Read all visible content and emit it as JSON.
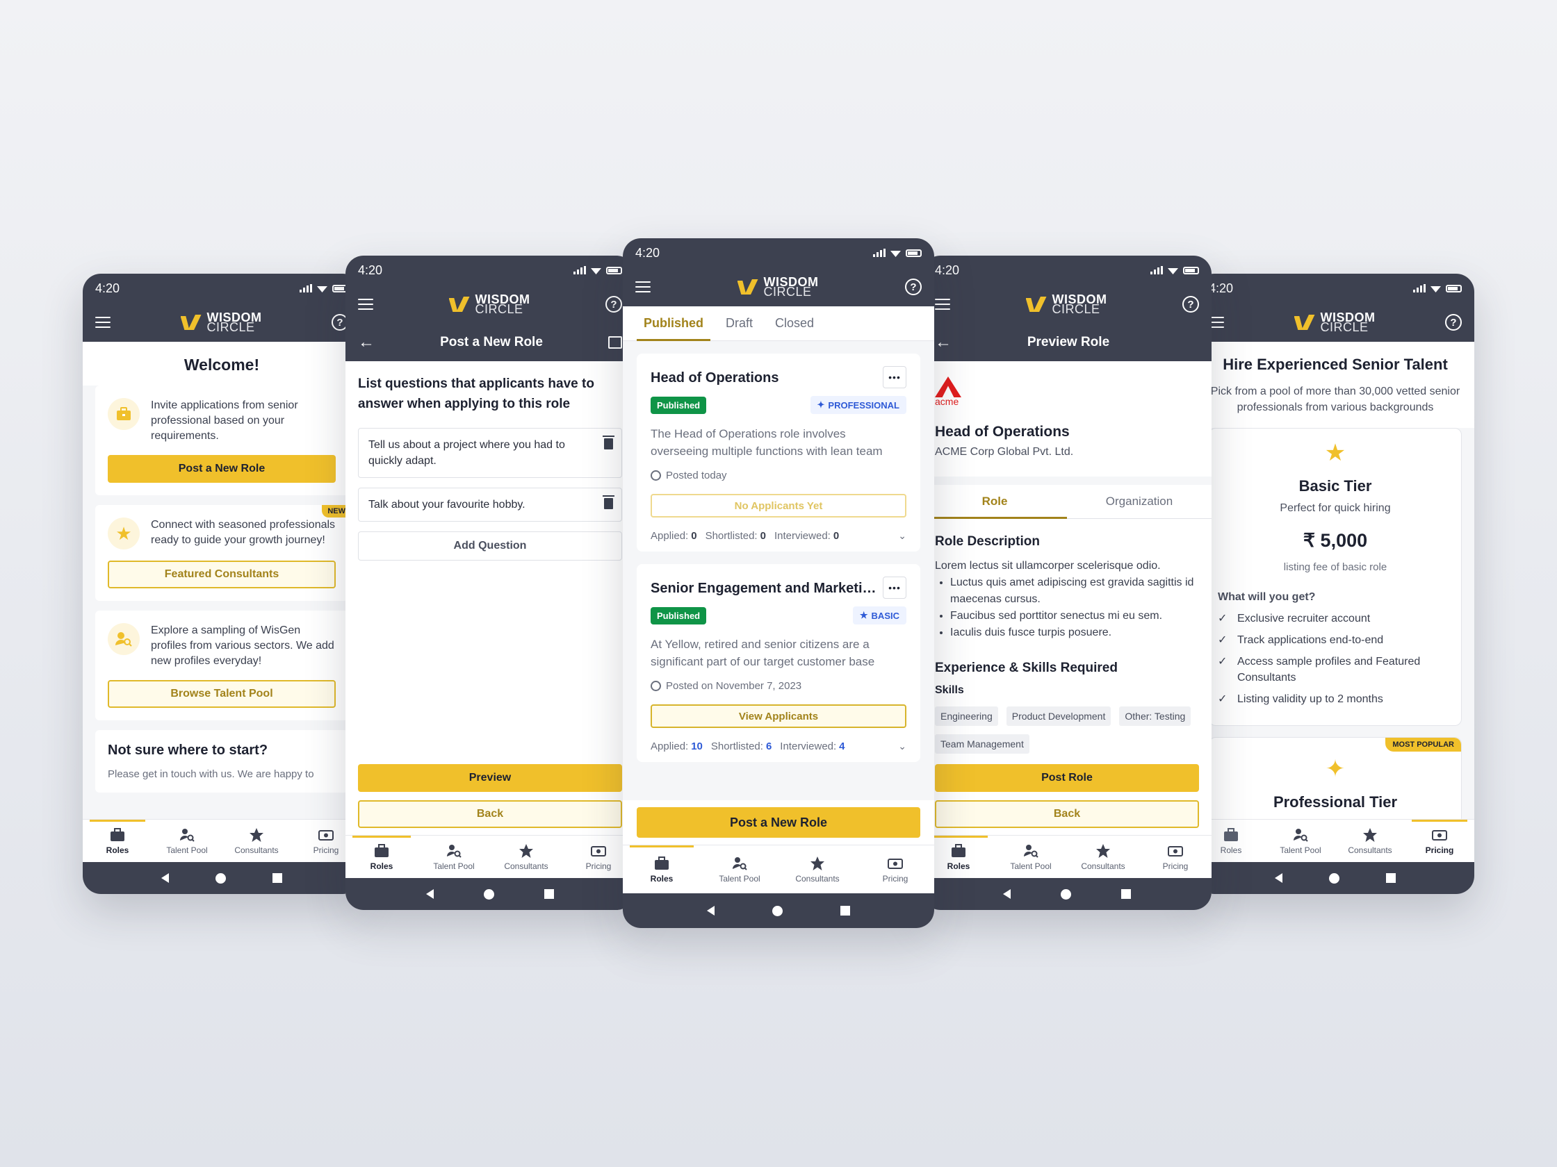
{
  "status_time": "4:20",
  "brand": {
    "line1": "WISDOM",
    "line2": "CIRCLE"
  },
  "help_glyph": "?",
  "bottom_nav": [
    "Roles",
    "Talent Pool",
    "Consultants",
    "Pricing"
  ],
  "screen1": {
    "title": "Welcome!",
    "card1_text": "Invite applications from senior professional based on your requirements.",
    "card1_button": "Post a New Role",
    "new_badge": "NEW",
    "card2_text": "Connect with seasoned professionals ready to guide your growth journey!",
    "card2_button": "Featured Consultants",
    "card3_text": "Explore a sampling of WisGen profiles from various sectors. We add new profiles everyday!",
    "card3_button": "Browse Talent Pool",
    "help_title": "Not sure where to start?",
    "help_text": "Please get in touch with us. We are happy to"
  },
  "screen2": {
    "title": "Post a New Role",
    "heading": "List questions that applicants have to answer when applying to this role",
    "questions": [
      "Tell us about a project where you had to quickly adapt.",
      "Talk about your favourite hobby."
    ],
    "add_question": "Add Question",
    "preview": "Preview",
    "back": "Back"
  },
  "screen3": {
    "tabs": [
      "Published",
      "Draft",
      "Closed"
    ],
    "roles": [
      {
        "title": "Head of Operations",
        "status": "Published",
        "tier": "PROFESSIONAL",
        "desc": "The Head of Operations role involves overseeing multiple functions with lean team",
        "posted": "Posted today",
        "button": "No Applicants Yet",
        "applied_label": "Applied:",
        "applied": "0",
        "shortlisted_label": "Shortlisted:",
        "shortlisted": "0",
        "interviewed_label": "Interviewed:",
        "interviewed": "0"
      },
      {
        "title": "Senior Engagement and Marketing",
        "status": "Published",
        "tier": "BASIC",
        "desc": "At Yellow, retired and senior citizens are a significant part of our target customer base",
        "posted": "Posted on November 7, 2023",
        "button": "View Applicants",
        "applied_label": "Applied:",
        "applied": "10",
        "shortlisted_label": "Shortlisted:",
        "shortlisted": "6",
        "interviewed_label": "Interviewed:",
        "interviewed": "4"
      }
    ],
    "post_button": "Post a New Role"
  },
  "screen4": {
    "title": "Preview Role",
    "company_logo_text": "acme",
    "role_title": "Head of Operations",
    "company": "ACME Corp Global Pvt. Ltd.",
    "tabs": [
      "Role",
      "Organization"
    ],
    "desc_title": "Role Description",
    "desc_intro": "Lorem lectus sit ullamcorper scelerisque odio.",
    "bullets": [
      "Luctus quis amet adipiscing est gravida sagittis id maecenas cursus.",
      "Faucibus sed porttitor senectus mi eu sem.",
      "Iaculis duis fusce turpis posuere."
    ],
    "exp_title": "Experience & Skills Required",
    "skills_label": "Skills",
    "skills": [
      "Engineering",
      "Product Development",
      "Other: Testing",
      "Team Management"
    ],
    "post": "Post Role",
    "back": "Back"
  },
  "screen5": {
    "title": "Hire Experienced Senior Talent",
    "subtitle": "Pick from a pool of more than 30,000 vetted senior professionals from various backgrounds",
    "basic": {
      "name": "Basic Tier",
      "sub": "Perfect for quick hiring",
      "price": "₹ 5,000",
      "fee": "listing fee of basic role",
      "what": "What will you get?",
      "features": [
        "Exclusive recruiter account",
        "Track applications end-to-end",
        "Access sample profiles and Featured Consultants",
        "Listing validity up to 2 months"
      ]
    },
    "badge": "MOST POPULAR",
    "pro_name": "Professional Tier"
  },
  "colors": {
    "primary": "#f0c02b",
    "dark": "#3d4150",
    "accent_text": "#a2831b",
    "published": "#0f9447",
    "tier_blue": "#2e5ad6"
  }
}
